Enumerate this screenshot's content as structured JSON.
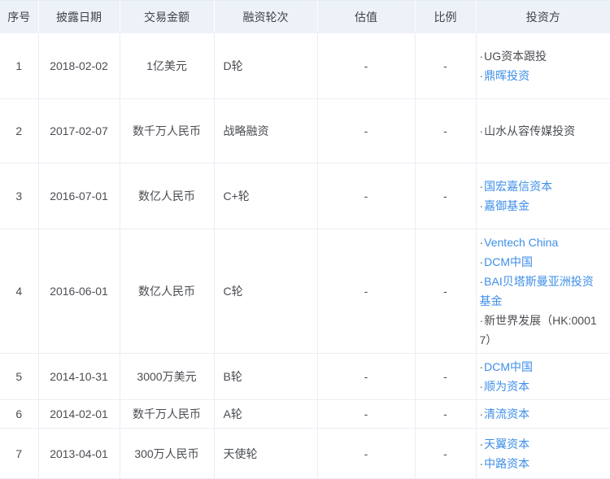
{
  "colors": {
    "header_bg": "#edf2f9",
    "link_blue": "#3e8ee8",
    "body_text": "#4a4d52",
    "grid_border": "#e9eef4"
  },
  "table": {
    "columns": [
      {
        "key": "no",
        "label": "序号"
      },
      {
        "key": "date",
        "label": "披露日期"
      },
      {
        "key": "amount",
        "label": "交易金额"
      },
      {
        "key": "round",
        "label": "融资轮次"
      },
      {
        "key": "valuation",
        "label": "估值"
      },
      {
        "key": "ratio",
        "label": "比例"
      },
      {
        "key": "investors",
        "label": "投资方"
      }
    ],
    "rows": [
      {
        "no": "1",
        "date": "2018-02-02",
        "amount": "1亿美元",
        "round": "D轮",
        "valuation": "-",
        "ratio": "-",
        "investors": [
          {
            "name": "UG资本跟投",
            "link": false
          },
          {
            "name": "鼎晖投资",
            "link": true
          }
        ]
      },
      {
        "no": "2",
        "date": "2017-02-07",
        "amount": "数千万人民币",
        "round": "战略融资",
        "valuation": "-",
        "ratio": "-",
        "investors": [
          {
            "name": "山水从容传媒投资",
            "link": false
          }
        ]
      },
      {
        "no": "3",
        "date": "2016-07-01",
        "amount": "数亿人民币",
        "round": "C+轮",
        "valuation": "-",
        "ratio": "-",
        "investors": [
          {
            "name": "国宏嘉信资本",
            "link": true
          },
          {
            "name": "嘉御基金",
            "link": true
          }
        ]
      },
      {
        "no": "4",
        "date": "2016-06-01",
        "amount": "数亿人民币",
        "round": "C轮",
        "valuation": "-",
        "ratio": "-",
        "investors": [
          {
            "name": "Ventech China",
            "link": true
          },
          {
            "name": "DCM中国",
            "link": true
          },
          {
            "name": "BAI贝塔斯曼亚洲投资基金",
            "link": true
          },
          {
            "name": "新世界发展（HK:00017）",
            "link": false
          }
        ]
      },
      {
        "no": "5",
        "date": "2014-10-31",
        "amount": "3000万美元",
        "round": "B轮",
        "valuation": "-",
        "ratio": "-",
        "investors": [
          {
            "name": "DCM中国",
            "link": true
          },
          {
            "name": "顺为资本",
            "link": true
          }
        ]
      },
      {
        "no": "6",
        "date": "2014-02-01",
        "amount": "数千万人民币",
        "round": "A轮",
        "valuation": "-",
        "ratio": "-",
        "investors": [
          {
            "name": "清流资本",
            "link": true
          }
        ]
      },
      {
        "no": "7",
        "date": "2013-04-01",
        "amount": "300万人民币",
        "round": "天使轮",
        "valuation": "-",
        "ratio": "-",
        "investors": [
          {
            "name": "天翼资本",
            "link": true
          },
          {
            "name": "中路资本",
            "link": true
          }
        ]
      }
    ]
  }
}
